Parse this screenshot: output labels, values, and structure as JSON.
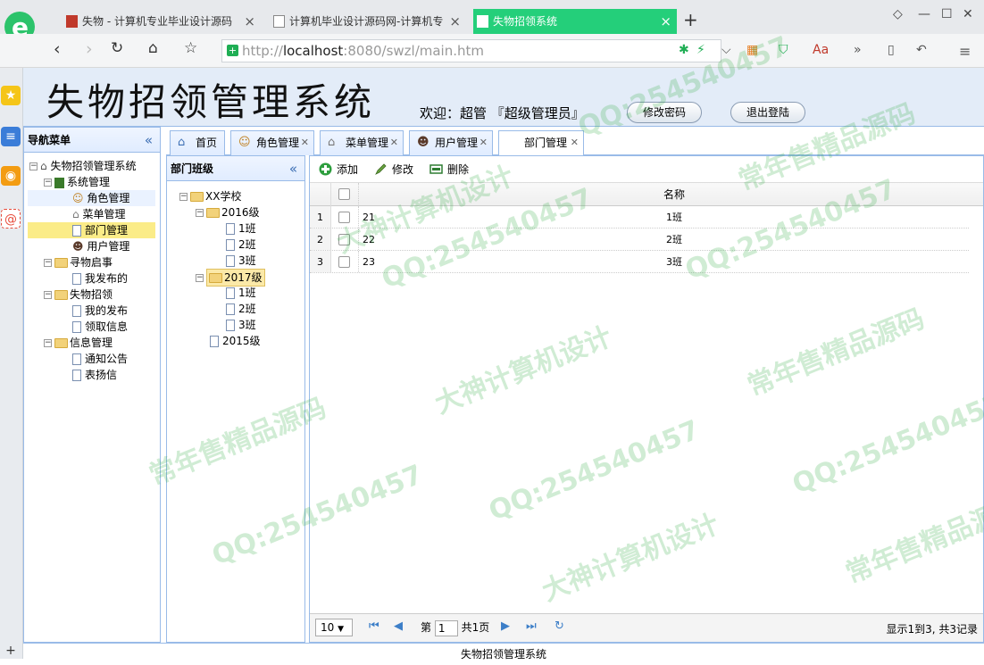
{
  "browser": {
    "tabs": [
      {
        "title": "失物 - 计算机专业毕业设计源码",
        "active": false
      },
      {
        "title": "计算机毕业设计源码网-计算机专",
        "active": false
      },
      {
        "title": "失物招领系统",
        "active": true
      }
    ],
    "url_scheme": "http://",
    "url_host": "localhost",
    "url_rest": ":8080/swzl/main.htm"
  },
  "header": {
    "title": "失物招领管理系统",
    "welcome": "欢迎：超管 『超级管理员』",
    "change_password": "修改密码",
    "logout": "退出登陆"
  },
  "nav_panel": {
    "title": "导航菜单",
    "collapse_icon": "«",
    "items": [
      {
        "label": "失物招领管理系统"
      },
      {
        "label": "系统管理"
      },
      {
        "label": "角色管理"
      },
      {
        "label": "菜单管理"
      },
      {
        "label": "部门管理"
      },
      {
        "label": "用户管理"
      },
      {
        "label": "寻物启事"
      },
      {
        "label": "我发布的"
      },
      {
        "label": "失物招领"
      },
      {
        "label": "我的发布"
      },
      {
        "label": "领取信息"
      },
      {
        "label": "信息管理"
      },
      {
        "label": "通知公告"
      },
      {
        "label": "表扬信"
      }
    ]
  },
  "main_tabs": [
    {
      "label": "首页",
      "closable": false
    },
    {
      "label": "角色管理",
      "closable": true
    },
    {
      "label": "菜单管理",
      "closable": true
    },
    {
      "label": "用户管理",
      "closable": true
    },
    {
      "label": "部门管理",
      "closable": true,
      "selected": true
    }
  ],
  "dept_panel": {
    "title": "部门班级",
    "collapse_icon": "«",
    "tree": [
      {
        "label": "XX学校"
      },
      {
        "label": "2016级"
      },
      {
        "label": "1班"
      },
      {
        "label": "2班"
      },
      {
        "label": "3班"
      },
      {
        "label": "2017级"
      },
      {
        "label": "1班"
      },
      {
        "label": "2班"
      },
      {
        "label": "3班"
      },
      {
        "label": "2015级"
      }
    ]
  },
  "toolbar": {
    "add": "添加",
    "edit": "修改",
    "delete": "删除"
  },
  "grid": {
    "column_name": "名称",
    "rows": [
      {
        "num": "1",
        "id": "21",
        "name": "1班"
      },
      {
        "num": "2",
        "id": "22",
        "name": "2班"
      },
      {
        "num": "3",
        "id": "23",
        "name": "3班"
      }
    ]
  },
  "pager": {
    "page_size": "10",
    "page_prefix": "第",
    "page_value": "1",
    "page_suffix": "共1页",
    "info": "显示1到3, 共3记录"
  },
  "footer": {
    "text": "失物招领管理系统"
  },
  "watermarks": [
    "QQ:254540457",
    "常年售精品源码",
    "大神计算机设计"
  ]
}
